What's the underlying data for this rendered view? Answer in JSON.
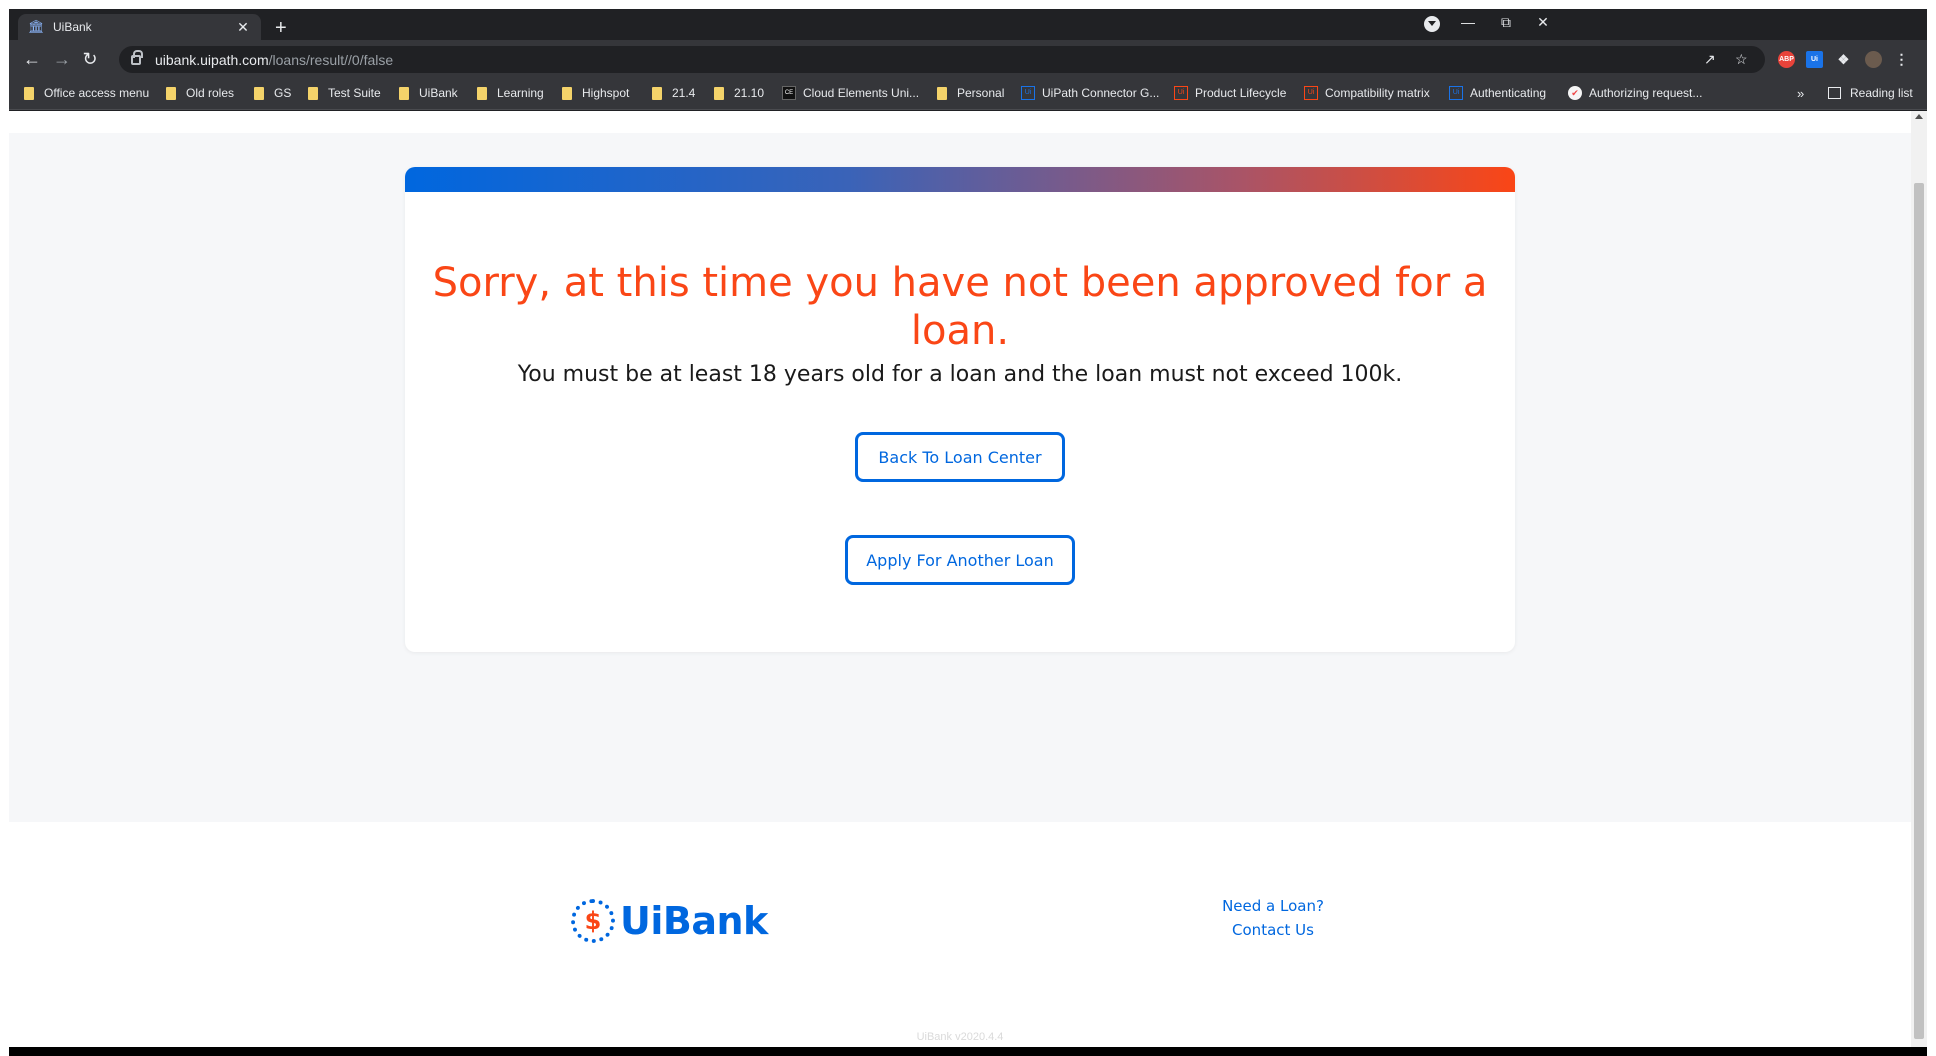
{
  "browser": {
    "tab_title": "UiBank",
    "url_host": "uibank.uipath.com",
    "url_path": "/loans/result//0/false"
  },
  "bookmarks": [
    {
      "label": "Office access menu",
      "icon": "folder-icon"
    },
    {
      "label": "Old roles",
      "icon": "folder-icon"
    },
    {
      "label": "GS",
      "icon": "folder-icon"
    },
    {
      "label": "Test Suite",
      "icon": "folder-icon"
    },
    {
      "label": "UiBank",
      "icon": "folder-icon"
    },
    {
      "label": "Learning",
      "icon": "folder-icon"
    },
    {
      "label": "Highspot",
      "icon": "folder-icon"
    },
    {
      "label": "21.4",
      "icon": "folder-icon"
    },
    {
      "label": "21.10",
      "icon": "folder-icon"
    },
    {
      "label": "Cloud Elements Uni...",
      "icon": "cloud-elements-icon"
    },
    {
      "label": "Personal",
      "icon": "folder-icon"
    },
    {
      "label": "UiPath Connector G...",
      "icon": "uipath-icon"
    },
    {
      "label": "Product Lifecycle",
      "icon": "uipath-orange-icon"
    },
    {
      "label": "Compatibility matrix",
      "icon": "uipath-orange-icon"
    },
    {
      "label": "Authenticating",
      "icon": "uipath-icon"
    },
    {
      "label": "Authorizing request...",
      "icon": "authorize-icon"
    }
  ],
  "reading_list": "Reading list",
  "result": {
    "heading": "Sorry, at this time you have not been approved for a loan.",
    "message": "You must be at least 18 years old for a loan and the loan must not exceed 100k.",
    "back_button": "Back To Loan Center",
    "apply_button": "Apply For Another Loan"
  },
  "footer": {
    "logo_text": "UiBank",
    "logo_symbol": "$",
    "link_loan": "Need a Loan?",
    "link_contact": "Contact Us",
    "version": "UiBank v2020.4.4"
  },
  "colors": {
    "accent_blue": "#0067df",
    "accent_orange": "#fa4616"
  }
}
